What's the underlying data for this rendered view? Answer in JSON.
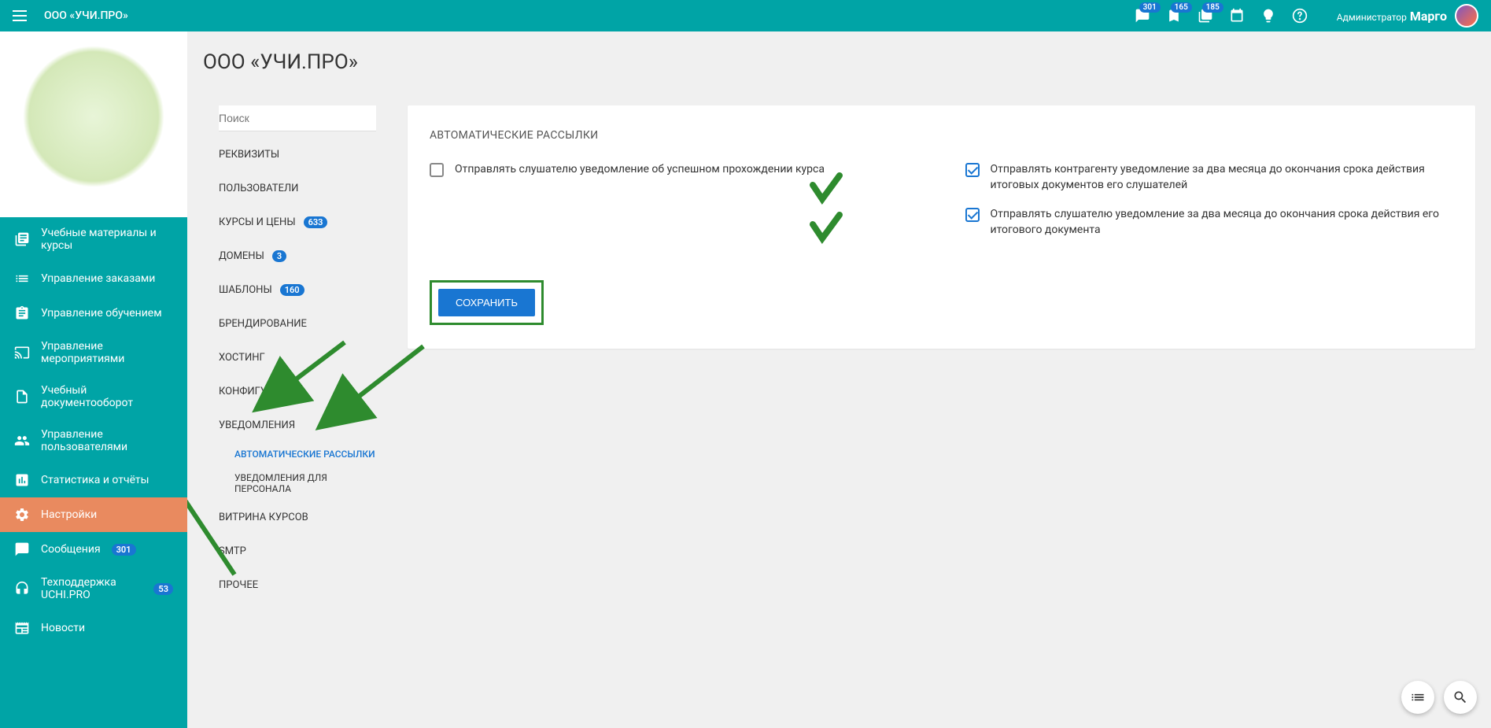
{
  "topbar": {
    "app_title": "ООО «УЧИ.ПРО»",
    "badges": {
      "chat": "301",
      "doc1": "165",
      "doc2": "185"
    },
    "user_role": "Администратор",
    "user_name": "Марго"
  },
  "sidebar": {
    "items": [
      {
        "label": "Учебные материалы и курсы"
      },
      {
        "label": "Управление заказами"
      },
      {
        "label": "Управление обучением"
      },
      {
        "label": "Управление мероприятиями"
      },
      {
        "label": "Учебный документооборот"
      },
      {
        "label": "Управление пользователями"
      },
      {
        "label": "Статистика и отчёты"
      },
      {
        "label": "Настройки"
      },
      {
        "label": "Сообщения",
        "badge": "301"
      },
      {
        "label": "Техподдержка UCHI.PRO",
        "badge": "53"
      },
      {
        "label": "Новости"
      }
    ]
  },
  "sec": {
    "title": "ООО «УЧИ.ПРО»",
    "search_placeholder": "Поиск",
    "items": [
      {
        "label": "РЕКВИЗИТЫ"
      },
      {
        "label": "ПОЛЬЗОВАТЕЛИ"
      },
      {
        "label": "КУРСЫ И ЦЕНЫ",
        "badge": "633"
      },
      {
        "label": "ДОМЕНЫ",
        "badge": "3"
      },
      {
        "label": "ШАБЛОНЫ",
        "badge": "160"
      },
      {
        "label": "БРЕНДИРОВАНИЕ"
      },
      {
        "label": "ХОСТИНГ"
      },
      {
        "label": "КОНФИГУРАЦИЯ"
      },
      {
        "label": "УВЕДОМЛЕНИЯ",
        "sub": [
          {
            "label": "АВТОМАТИЧЕСКИЕ РАССЫЛКИ",
            "active": true
          },
          {
            "label": "УВЕДОМЛЕНИЯ ДЛЯ ПЕРСОНАЛА"
          }
        ]
      },
      {
        "label": "ВИТРИНА КУРСОВ"
      },
      {
        "label": "SMTP"
      },
      {
        "label": "ПРОЧЕЕ"
      }
    ]
  },
  "main": {
    "card_title": "АВТОМАТИЧЕСКИЕ РАССЫЛКИ",
    "check1": "Отправлять слушателю уведомление об успешном прохождении курса",
    "check2": "Отправлять контрагенту уведомление за два месяца до окончания срока действия итоговых документов его слушателей",
    "check3": "Отправлять слушателю уведомление за два месяца до окончания срока действия его итогового документа",
    "save": "СОХРАНИТЬ"
  }
}
